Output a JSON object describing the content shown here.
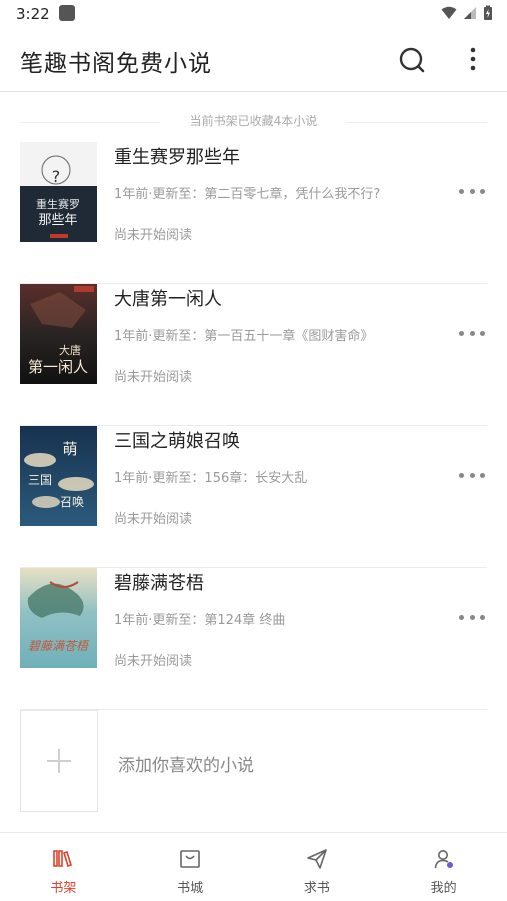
{
  "status_bar": {
    "time": "3:22"
  },
  "app_bar": {
    "title": "笔趣书阁免费小说"
  },
  "shelf": {
    "count_text": "当前书架已收藏4本小说"
  },
  "books": [
    {
      "title": "重生赛罗那些年",
      "update": "1年前·更新至：第二百零七章，凭什么我不行?",
      "status": "尚未开始阅读",
      "cover_text": "重生赛罗 那些年"
    },
    {
      "title": "大唐第一闲人",
      "update": "1年前·更新至：第一百五十一章《图财害命》",
      "status": "尚未开始阅读",
      "cover_text": "大唐 第一闲人"
    },
    {
      "title": "三国之萌娘召唤",
      "update": "1年前·更新至：156章：长安大乱",
      "status": "尚未开始阅读",
      "cover_text": "萌 三国 召唤"
    },
    {
      "title": "碧藤满苍梧",
      "update": "1年前·更新至：第124章 终曲",
      "status": "尚未开始阅读",
      "cover_text": "碧藤满苍梧"
    }
  ],
  "add_book": {
    "label": "添加你喜欢的小说"
  },
  "tabs": [
    {
      "label": "书架",
      "icon": "bookshelf-icon",
      "active": true
    },
    {
      "label": "书城",
      "icon": "store-icon",
      "active": false
    },
    {
      "label": "求书",
      "icon": "send-icon",
      "active": false
    },
    {
      "label": "我的",
      "icon": "profile-icon",
      "active": false
    }
  ],
  "colors": {
    "accent": "#e0422b",
    "text": "#222222",
    "muted": "#9a9a9a"
  }
}
